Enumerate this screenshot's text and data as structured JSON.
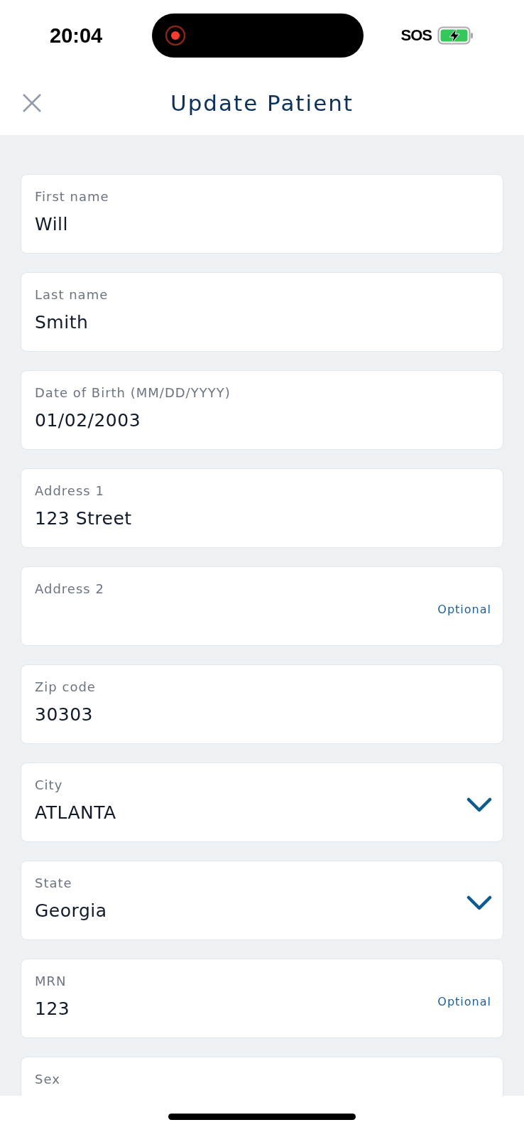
{
  "status_bar": {
    "time": "20:04",
    "sos": "SOS",
    "recording": true,
    "charging": true
  },
  "header": {
    "title": "Update Patient"
  },
  "fields": [
    {
      "kind": "text",
      "label": "First name",
      "value": "Will"
    },
    {
      "kind": "text",
      "label": "Last name",
      "value": "Smith"
    },
    {
      "kind": "text",
      "label": "Date of Birth (MM/DD/YYYY)",
      "value": "01/02/2003"
    },
    {
      "kind": "text",
      "label": "Address 1",
      "value": "123 Street"
    },
    {
      "kind": "text",
      "label": "Address 2",
      "hint": "Optional"
    },
    {
      "kind": "text",
      "label": "Zip code",
      "value": "30303"
    },
    {
      "kind": "select",
      "label": "City",
      "value": "ATLANTA"
    },
    {
      "kind": "select",
      "label": "State",
      "value": "Georgia"
    },
    {
      "kind": "text",
      "label": "MRN",
      "value": "123",
      "hint": "Optional"
    },
    {
      "kind": "text",
      "label": "Sex"
    }
  ]
}
